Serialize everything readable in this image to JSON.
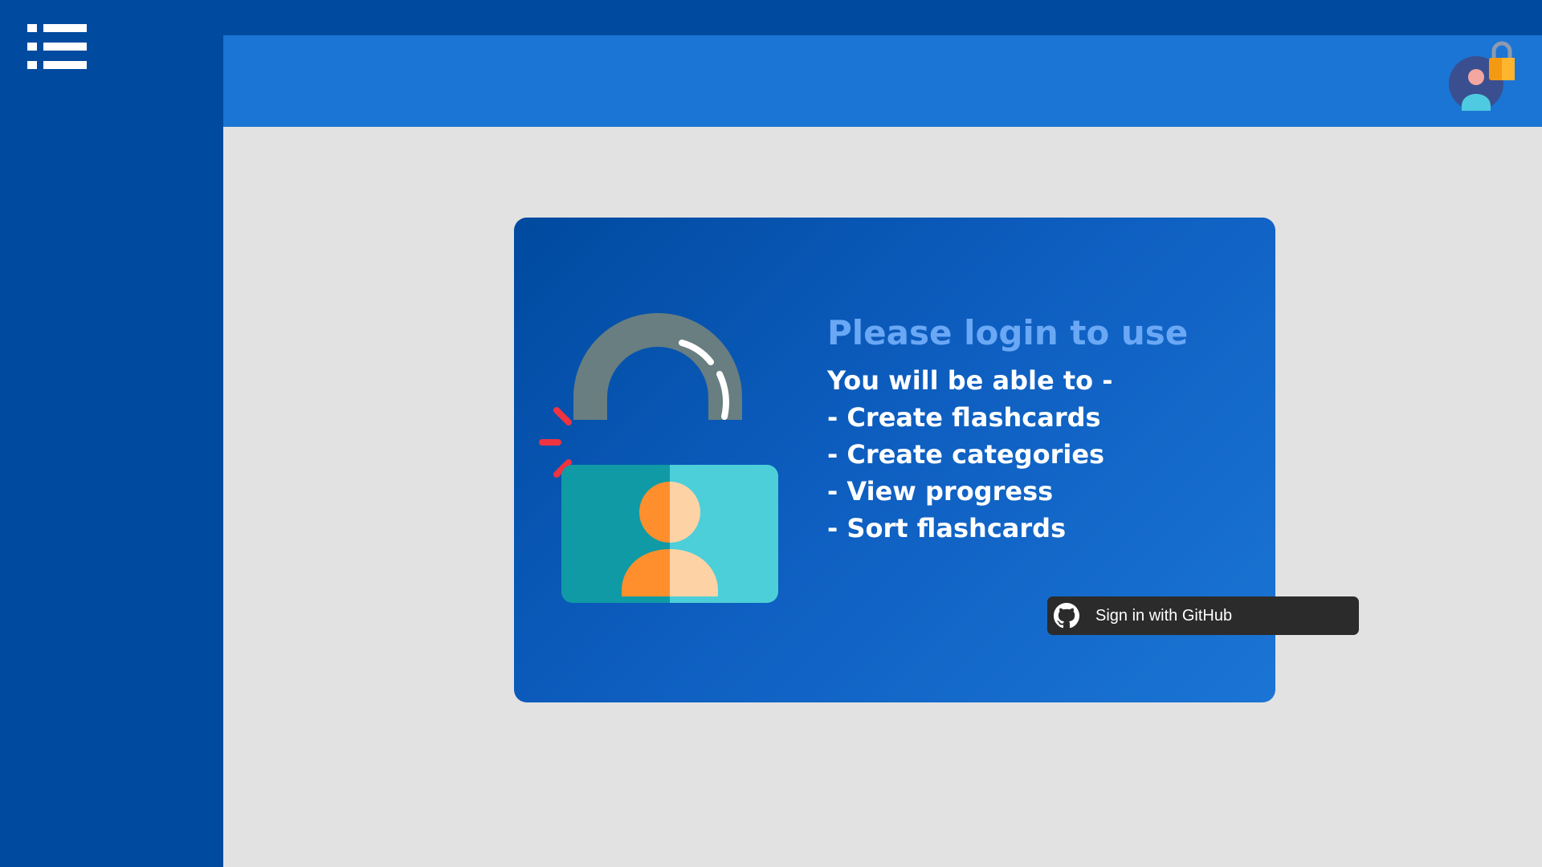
{
  "sidebar": {
    "menu_icon": "list-menu-icon"
  },
  "topbar": {
    "account_icon": "user-lock-avatar-icon"
  },
  "login_card": {
    "illustration_icon": "padlock-user-icon",
    "title": "Please login to use",
    "subtitle": "You will be able to -",
    "features": [
      "- Create flashcards",
      "- Create categories",
      "- View progress",
      "- Sort flashcards"
    ],
    "github_button": {
      "label": "Sign in with GitHub",
      "icon": "github-icon"
    }
  },
  "colors": {
    "sidebar_bg": "#004a9f",
    "topbar_bg": "#1b75d4",
    "content_bg": "#e2e2e2",
    "title": "#6aa8f5",
    "button_bg": "#2b2b2b"
  }
}
